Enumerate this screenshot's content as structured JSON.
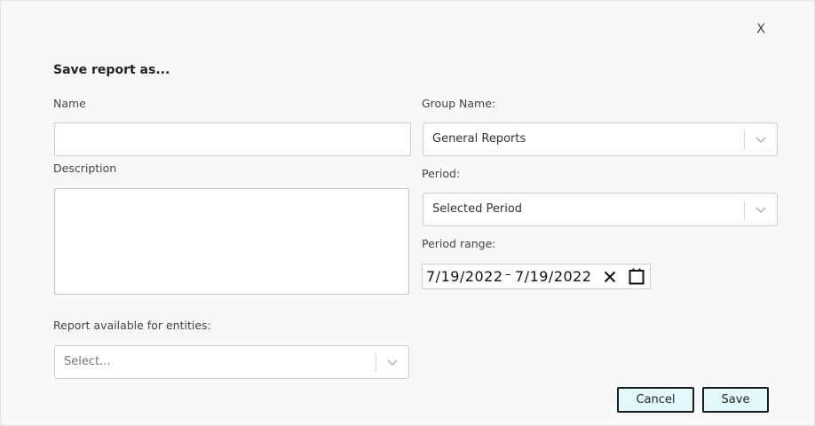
{
  "dialog": {
    "close_label": "X",
    "title": "Save report as..."
  },
  "form": {
    "name_label": "Name",
    "name_value": "",
    "description_label": "Description",
    "description_value": "",
    "group_name_label": "Group Name:",
    "group_name_value": "General Reports",
    "period_label": "Period:",
    "period_value": "Selected Period",
    "period_range_label": "Period range:",
    "period_range_start": "7/19/2022",
    "period_range_separator": "–",
    "period_range_end": "7/19/2022",
    "entities_label": "Report available for entities:",
    "entities_placeholder": "Select..."
  },
  "buttons": {
    "cancel_label": "Cancel",
    "save_label": "Save"
  },
  "icons": {
    "close": "close-icon",
    "dropdown": "chevron-down-icon",
    "clear": "clear-icon",
    "calendar": "calendar-icon"
  }
}
